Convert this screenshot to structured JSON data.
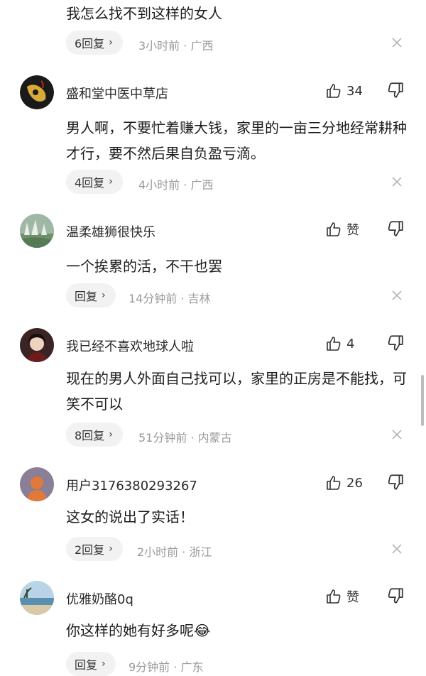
{
  "top_fragment": {
    "text": "我怎么找不到这样的女人",
    "reply_label": "6回复",
    "meta": "3小时前 · 广西"
  },
  "comments": [
    {
      "username": "盛和堂中医中草店",
      "likes": "34",
      "text": "男人啊，不要忙着赚大钱，家里的一亩三分地经常耕种才行，要不然后果自负盈亏滴。",
      "reply_label": "4回复",
      "meta": "4小时前 · 广西",
      "avatar_icon": "dark-logo-avatar"
    },
    {
      "username": "温柔雄狮很快乐",
      "likes": "赞",
      "text": "一个挨累的活，不干也罢",
      "reply_label": "回复",
      "meta": "14分钟前 · 吉林",
      "avatar_icon": "landscape-avatar"
    },
    {
      "username": "我已经不喜欢地球人啦",
      "likes": "4",
      "text": "现在的男人外面自己找可以，家里的正房是不能找，可笑不可以",
      "reply_label": "8回复",
      "meta": "51分钟前 · 内蒙古",
      "avatar_icon": "portrait-avatar"
    },
    {
      "username": "用户3176380293267",
      "likes": "26",
      "text": "这女的说出了实话！",
      "reply_label": "2回复",
      "meta": "2小时前 · 浙江",
      "avatar_icon": "default-user-avatar"
    },
    {
      "username": "优雅奶酪0q",
      "likes": "赞",
      "text": "你这样的她有好多呢",
      "emoji": "😂",
      "reply_label": "回复",
      "meta": "9分钟前 · 广东",
      "avatar_icon": "beach-avatar"
    }
  ],
  "colors": {
    "text": "#1c1c1c",
    "meta": "#9a9a9a",
    "pill_bg": "#f2f2f2"
  }
}
